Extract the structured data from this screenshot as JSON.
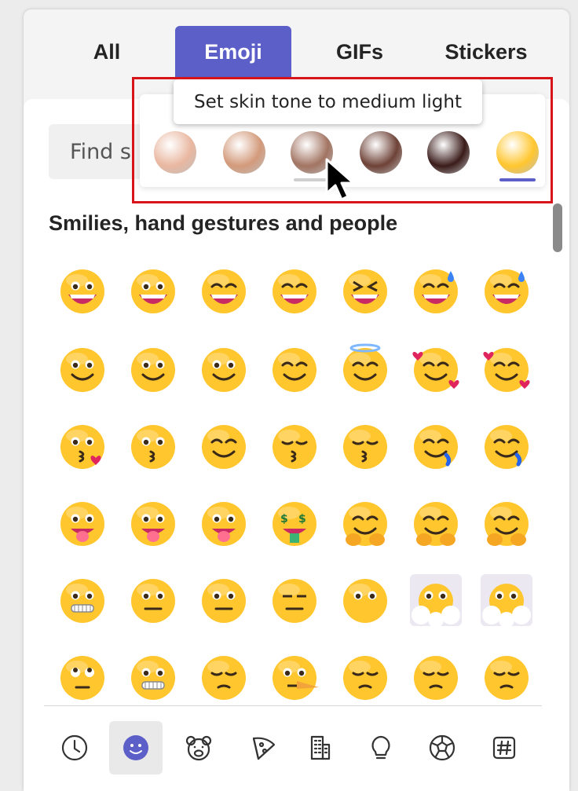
{
  "tabs": [
    {
      "label": "All",
      "active": false
    },
    {
      "label": "Emoji",
      "active": true
    },
    {
      "label": "GIFs",
      "active": false
    },
    {
      "label": "Stickers",
      "active": false
    }
  ],
  "search": {
    "visible_text": "Find s"
  },
  "skin_tone": {
    "tooltip": "Set skin tone to medium light",
    "tones": [
      {
        "name": "light",
        "color": "#e9b7a0"
      },
      {
        "name": "medium-light",
        "color": "#d39a7b"
      },
      {
        "name": "medium",
        "color": "#a27462"
      },
      {
        "name": "medium-dark",
        "color": "#6e4237"
      },
      {
        "name": "dark",
        "color": "#3a1c1a"
      },
      {
        "name": "default",
        "color": "#ffc62e"
      }
    ],
    "selected": "default",
    "hovered": "medium"
  },
  "section_title": "Smilies, hand gestures and people",
  "emoji_rows": [
    [
      "grinning-face",
      "grinning-face-big-eyes",
      "grinning-face-smiling-eyes",
      "beaming-face",
      "grinning-squinting-face",
      "grinning-face-sweat",
      "grinning-face-sweat"
    ],
    [
      "slightly-smiling-face",
      "upside-down-face",
      "winking-face",
      "smiling-face-smiling-eyes",
      "smiling-face-halo",
      "smiling-face-hearts",
      "smiling-face-hearts"
    ],
    [
      "face-blowing-kiss",
      "kissing-face",
      "smiling-face",
      "kissing-face-closed-eyes",
      "kissing-face-smiling-eyes",
      "face-savoring-food",
      "face-savoring-food"
    ],
    [
      "winking-face-tongue",
      "zany-face",
      "squinting-face-tongue",
      "money-mouth-face",
      "hugging-face",
      "face-hand-over-mouth",
      "face-hand-over-mouth"
    ],
    [
      "zipper-mouth-face",
      "face-raised-eyebrow",
      "neutral-face",
      "expressionless-face",
      "face-without-mouth",
      "face-in-clouds",
      "face-in-clouds"
    ],
    [
      "face-rolling-eyes",
      "grimacing-face",
      "face-exhaling",
      "lying-face",
      "relieved-face",
      "pensive-face",
      "pensive-face"
    ]
  ],
  "categories": [
    {
      "name": "recent",
      "icon": "clock-icon",
      "active": false
    },
    {
      "name": "smilies",
      "icon": "smiley-icon",
      "active": true
    },
    {
      "name": "animals",
      "icon": "bear-icon",
      "active": false
    },
    {
      "name": "food",
      "icon": "pizza-icon",
      "active": false
    },
    {
      "name": "places",
      "icon": "building-icon",
      "active": false
    },
    {
      "name": "objects",
      "icon": "lightbulb-icon",
      "active": false
    },
    {
      "name": "activities",
      "icon": "soccer-ball-icon",
      "active": false
    },
    {
      "name": "symbols",
      "icon": "hashtag-icon",
      "active": false
    }
  ],
  "colors": {
    "accent": "#5b5fc7",
    "highlight_box": "#d6141a",
    "emoji_face": "#ffc62e",
    "emoji_mouth": "#c92a63"
  }
}
